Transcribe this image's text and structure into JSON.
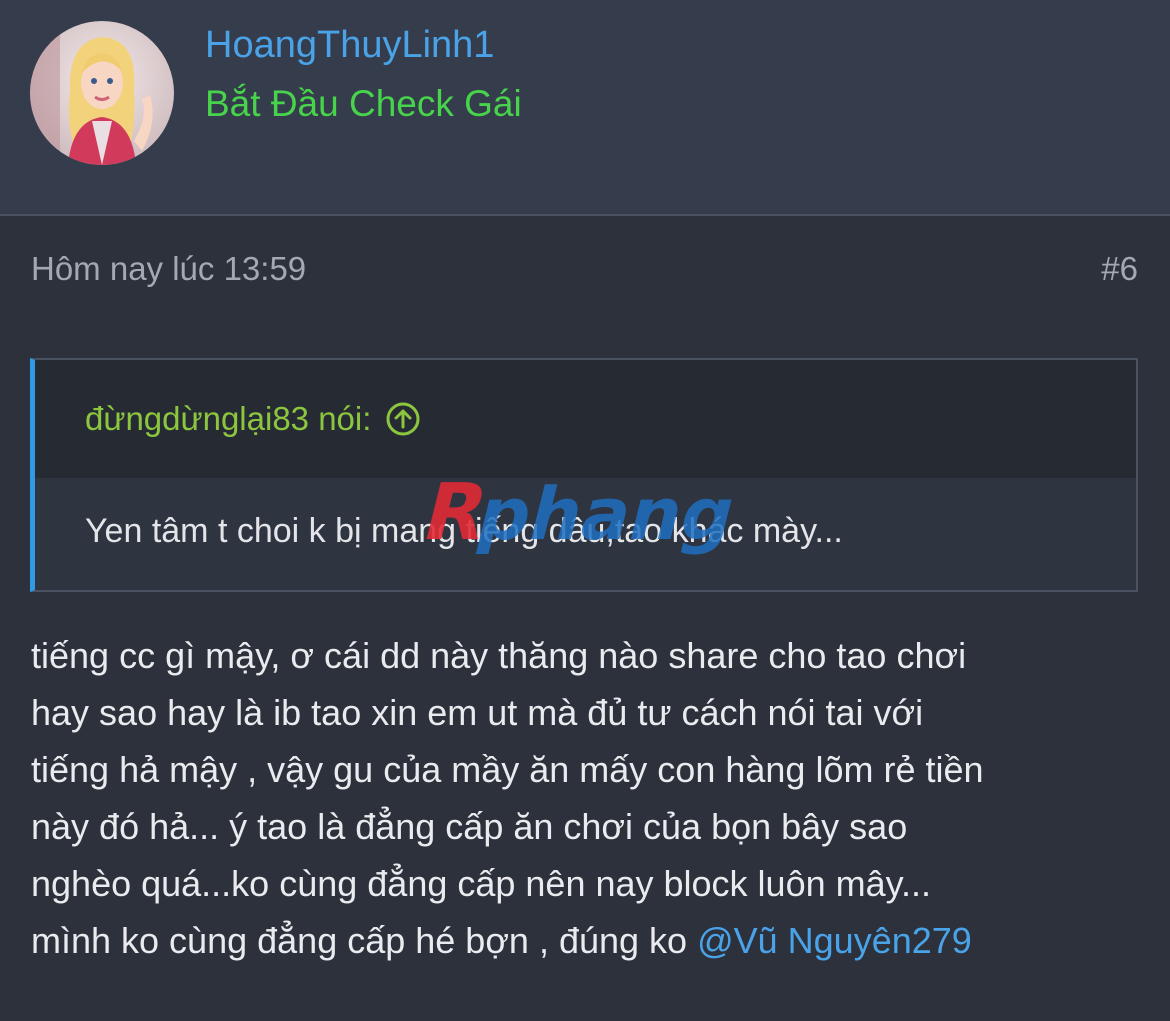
{
  "user": {
    "name": "HoangThuyLinh1",
    "title": "Bắt Đầu Check Gái",
    "avatar_icon": "user-avatar"
  },
  "post": {
    "time": "Hôm nay lúc 13:59",
    "number": "#6",
    "quote": {
      "author": "đừngdừnglại83 nói:",
      "text": "Yen tâm t choi k bị mang tiếng dâu,tao khác mày..."
    },
    "body_lines": [
      "tiếng cc gì mậy, ơ cái dd này thăng nào share cho tao chơi",
      "hay sao hay là ib tao xin em ut mà đủ tư cách nói tai với",
      "tiếng hả mậy , vậy gu của mầy ăn mấy con hàng lõm rẻ tiền",
      "này đó hả... ý tao là đẳng cấp ăn chơi của bọn bây sao",
      "nghèo quá...ko cùng đẳng cấp nên nay block luôn mây...",
      "mình ko cùng đẳng cấp hé bợn , đúng ko "
    ],
    "mention": "@Vũ Nguyên279"
  },
  "watermark": {
    "text": "Rphang"
  },
  "colors": {
    "username": "#4aa3e8",
    "usertitle": "#47d34b",
    "quote_author": "#8cc63f",
    "quote_bar": "#2f9be4",
    "background": "#2c313b"
  }
}
